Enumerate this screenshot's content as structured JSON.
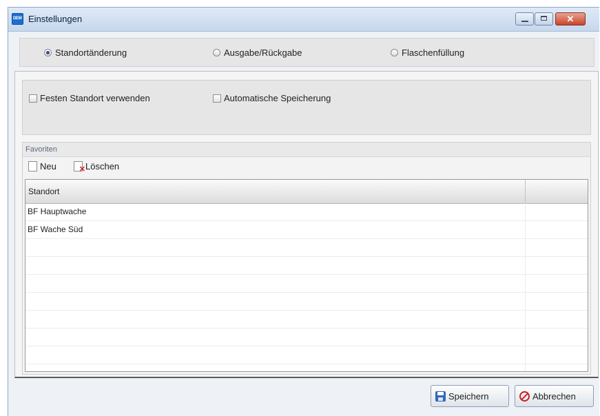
{
  "window": {
    "title": "Einstellungen",
    "app_icon_text": "DEW"
  },
  "mode_radios": [
    {
      "label": "Standortänderung",
      "selected": true
    },
    {
      "label": "Ausgabe/Rückgabe",
      "selected": false
    },
    {
      "label": "Flaschenfüllung",
      "selected": false
    }
  ],
  "options": {
    "fixed_location_label": "Festen Standort verwenden",
    "auto_save_label": "Automatische Speicherung"
  },
  "favorites": {
    "header": "Favoriten",
    "new_label": "Neu",
    "delete_label": "Löschen",
    "column_header": "Standort",
    "rows": [
      "BF Hauptwache",
      "BF Wache Süd"
    ]
  },
  "buttons": {
    "save_label": "Speichern",
    "cancel_label": "Abbrechen"
  }
}
